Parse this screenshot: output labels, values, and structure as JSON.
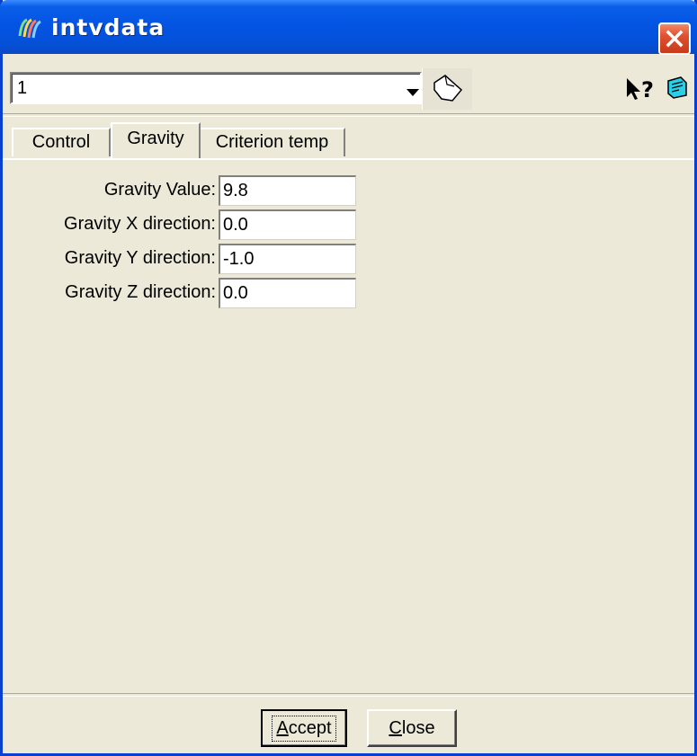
{
  "window": {
    "title": "intvdata",
    "colors": {
      "titlebar": "#0454e3",
      "face": "#ece9d8",
      "close": "#e0512f"
    }
  },
  "toolbar": {
    "combo_value": "1",
    "icons": [
      "app-icon",
      "dropdown-arrow-icon",
      "hand-pointer-icon",
      "context-help-icon",
      "notes-icon"
    ]
  },
  "tabs": [
    {
      "label": "Control",
      "active": false
    },
    {
      "label": "Gravity",
      "active": true
    },
    {
      "label": "Criterion temp",
      "active": false
    }
  ],
  "fields": [
    {
      "label": "Gravity Value:",
      "value": "9.8"
    },
    {
      "label": "Gravity X direction:",
      "value": "0.0"
    },
    {
      "label": "Gravity Y direction:",
      "value": "-1.0"
    },
    {
      "label": "Gravity Z direction:",
      "value": "0.0"
    }
  ],
  "buttons": {
    "accept": {
      "mnemonic": "A",
      "rest": "ccept"
    },
    "close": {
      "mnemonic": "C",
      "rest": "lose"
    }
  }
}
